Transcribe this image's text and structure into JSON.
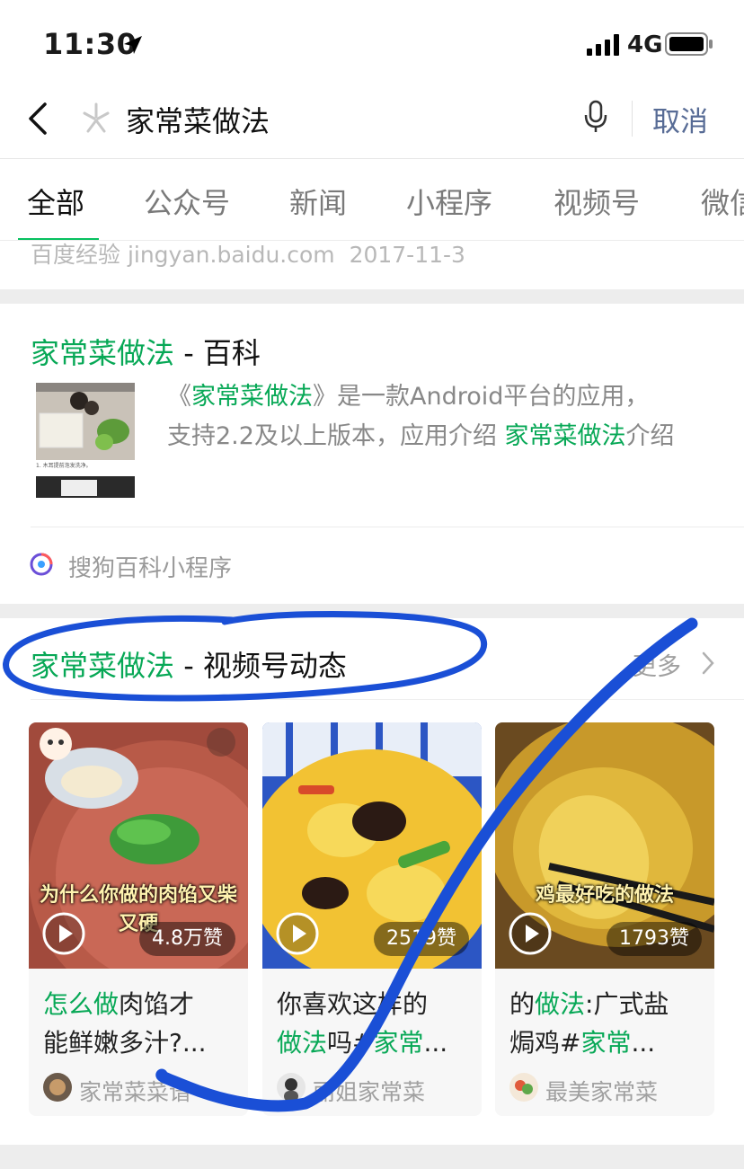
{
  "status_bar": {
    "time": "11:30",
    "network": "4G"
  },
  "search": {
    "query": "家常菜做法",
    "cancel_label": "取消"
  },
  "tabs": [
    {
      "label": "全部",
      "active": true
    },
    {
      "label": "公众号"
    },
    {
      "label": "新闻"
    },
    {
      "label": "小程序"
    },
    {
      "label": "视频号"
    },
    {
      "label": "微信"
    }
  ],
  "prev_result": {
    "source": "百度经验 jingyan.baidu.com",
    "date": "2017-11-3"
  },
  "baike": {
    "title_keyword": "家常菜做法",
    "title_suffix": " - 百科",
    "desc_line1_pre": "《",
    "desc_line1_kw": "家常菜做法",
    "desc_line1_post": "》是一款Android平台的应用，",
    "desc_line2_pre": "支持2.2及以上版本，应用介绍 ",
    "desc_line2_kw": "家常菜做法",
    "desc_line2_post": "介绍",
    "thumb_caption": "1. 木耳提前泡发洗净。",
    "source_label": "搜狗百科小程序"
  },
  "video_section": {
    "title_keyword": "家常菜做法",
    "title_suffix": " - 视频号动态",
    "more_label": "更多",
    "cards": [
      {
        "likes": "4.8万赞",
        "overlay": "为什么你做的肉馅又柴又硬",
        "line1_kw": "怎么做",
        "line1_post": "肉馅才",
        "line2": "能鲜嫩多汁?...",
        "author": "家常菜菜谱"
      },
      {
        "likes": "2519赞",
        "overlay": "",
        "line1_pre": "你喜欢这样的",
        "line2_kw": "做法",
        "line2_post": "吗#",
        "line2_kw2": "家常",
        "line2_tail": "...",
        "author": "丽姐家常菜"
      },
      {
        "likes": "1793赞",
        "overlay": "鸡最好吃的做法",
        "line1_pre": "的",
        "line1_kw": "做法",
        "line1_post": ":广式盐",
        "line2_pre": "焗鸡#",
        "line2_kw": "家常",
        "line2_tail": "...",
        "author": "最美家常菜"
      }
    ]
  },
  "colors": {
    "accent_green": "#07a856",
    "link_blue": "#576b95",
    "annotation_blue": "#1a4fd6"
  },
  "icons": [
    "location-arrow-icon",
    "signal-icon",
    "battery-icon",
    "back-chevron-icon",
    "wechat-search-logo-icon",
    "microphone-icon",
    "sogou-baike-icon",
    "chevron-right-icon",
    "play-icon"
  ]
}
